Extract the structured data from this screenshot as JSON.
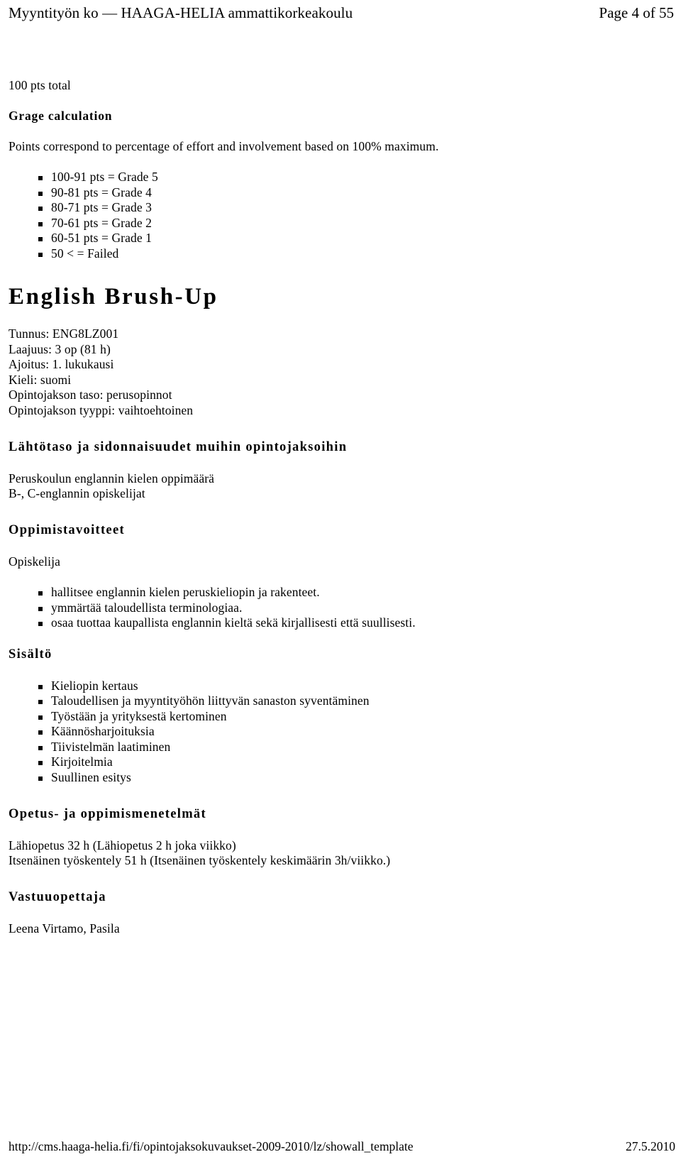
{
  "header": {
    "title": "Myyntityön ko — HAAGA-HELIA ammattikorkeakoulu",
    "page_label": "Page 4 of 55"
  },
  "grading": {
    "total_line": "100 pts total",
    "heading": "Grage calculation",
    "intro": "Points correspond to percentage of effort and involvement based on 100% maximum.",
    "scale": [
      "100-91 pts = Grade 5",
      "90-81 pts = Grade 4",
      "80-71 pts = Grade 3",
      "70-61 pts = Grade 2",
      "60-51 pts = Grade 1",
      "50 < = Failed"
    ]
  },
  "course": {
    "title": "English Brush-Up",
    "meta": [
      "Tunnus: ENG8LZ001",
      "Laajuus: 3 op (81 h)",
      "Ajoitus: 1. lukukausi",
      "Kieli: suomi",
      "Opintojakson taso: perusopinnot",
      "Opintojakson tyyppi: vaihtoehtoinen"
    ],
    "prerequisites": {
      "heading": "Lähtötaso ja sidonnaisuudet muihin opintojaksoihin",
      "lines": [
        "Peruskoulun englannin kielen oppimäärä",
        "B-, C-englannin opiskelijat"
      ]
    },
    "objectives": {
      "heading": "Oppimistavoitteet",
      "lead": "Opiskelija",
      "items": [
        "hallitsee englannin kielen peruskieliopin ja rakenteet.",
        "ymmärtää taloudellista terminologiaa.",
        "osaa tuottaa kaupallista englannin kieltä sekä kirjallisesti että suullisesti."
      ]
    },
    "contents": {
      "heading": "Sisältö",
      "items": [
        "Kieliopin kertaus",
        "Taloudellisen ja myyntityöhön liittyvän sanaston syventäminen",
        "Työstään ja yrityksestä kertominen",
        "Käännösharjoituksia",
        "Tiivistelmän laatiminen",
        "Kirjoitelmia",
        "Suullinen esitys"
      ]
    },
    "methods": {
      "heading": "Opetus- ja oppimismenetelmät",
      "lines": [
        "Lähiopetus 32 h (Lähiopetus 2 h joka viikko)",
        "Itsenäinen työskentely 51 h (Itsenäinen työskentely keskimäärin 3h/viikko.)"
      ]
    },
    "teacher": {
      "heading": "Vastuuopettaja",
      "name": "Leena Virtamo, Pasila"
    }
  },
  "footer": {
    "url": "http://cms.haaga-helia.fi/fi/opintojaksokuvaukset-2009-2010/lz/showall_template",
    "date": "27.5.2010"
  }
}
